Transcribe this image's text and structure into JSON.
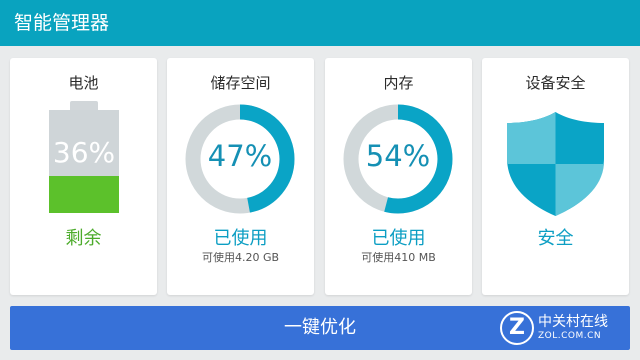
{
  "app": {
    "title": "智能管理器"
  },
  "colors": {
    "appbar": "#09a3bf",
    "ring_active": "#0aa4c6",
    "ring_track": "#d1d8da",
    "battery_fill": "#5cc12b",
    "battery_body": "#cfd5d8",
    "status_green": "#4cab2b",
    "status_blue": "#0c9ec3",
    "button": "#3771d8"
  },
  "cards": {
    "battery": {
      "title": "电池",
      "percent_label": "36%",
      "percent": 36,
      "status": "剩余"
    },
    "storage": {
      "title": "储存空间",
      "percent_label": "47%",
      "percent": 47,
      "status": "已使用",
      "sub": "可使用4.20 GB"
    },
    "memory": {
      "title": "内存",
      "percent_label": "54%",
      "percent": 54,
      "status": "已使用",
      "sub": "可使用410 MB"
    },
    "security": {
      "title": "设备安全",
      "status": "安全",
      "icon": "shield-icon"
    }
  },
  "action": {
    "label": "一键优化"
  },
  "watermark": {
    "logo_letter": "Z",
    "cn": "中关村在线",
    "en": "ZOL.COM.CN"
  }
}
